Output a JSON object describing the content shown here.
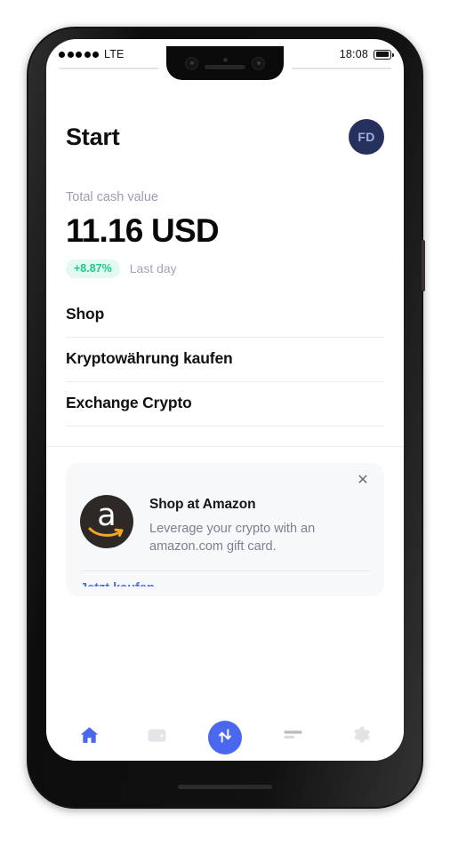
{
  "status_bar": {
    "carrier": "LTE",
    "signal_dots": 5,
    "time": "18:08",
    "battery_icon": "battery-full-icon"
  },
  "header": {
    "title": "Start",
    "avatar_initials": "FD"
  },
  "balance": {
    "label": "Total cash value",
    "value": "11.16 USD",
    "change_badge": "+8.87%",
    "change_period": "Last day"
  },
  "menu": {
    "items": [
      {
        "label": "Shop"
      },
      {
        "label": "Kryptowährung kaufen"
      },
      {
        "label": "Exchange Crypto"
      }
    ]
  },
  "promo": {
    "close_icon": "close-icon",
    "logo_icon": "amazon-logo-icon",
    "title": "Shop at Amazon",
    "description": "Leverage your crypto with an amazon.com gift card.",
    "link_text": "Jetzt kaufen"
  },
  "bottom_nav": {
    "items": [
      {
        "name": "nav-home",
        "icon": "home-icon",
        "active": true
      },
      {
        "name": "nav-wallet",
        "icon": "wallet-icon",
        "active": false
      },
      {
        "name": "nav-exchange",
        "icon": "exchange-arrows-icon",
        "active": false
      },
      {
        "name": "nav-card",
        "icon": "credit-card-icon",
        "active": false
      },
      {
        "name": "nav-settings",
        "icon": "gear-icon",
        "active": false
      }
    ]
  },
  "colors": {
    "accent_blue": "#4a68ed",
    "avatar_bg": "#26305c",
    "badge_green_text": "#1fc78c",
    "badge_green_bg": "#e3faf0",
    "amazon_dark": "#2d2926",
    "amazon_orange": "#f5a623"
  }
}
